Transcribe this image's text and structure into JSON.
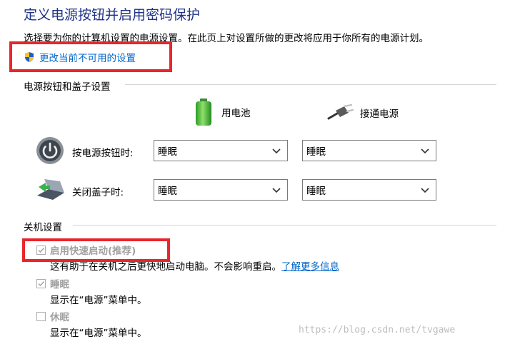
{
  "page": {
    "title": "定义电源按钮并启用密码保护",
    "description": "选择要为你的计算机设置的电源设置。在此页上对设置所做的更改将应用于你所有的电源计划。",
    "change_link": "更改当前不可用的设置"
  },
  "power_section": {
    "title": "电源按钮和盖子设置",
    "col_battery": "用电池",
    "col_plugged": "接通电源",
    "rows": [
      {
        "label": "按电源按钮时:",
        "battery": "睡眠",
        "plugged": "睡眠"
      },
      {
        "label": "关闭盖子时:",
        "battery": "睡眠",
        "plugged": "睡眠"
      }
    ]
  },
  "shutdown_section": {
    "title": "关机设置",
    "fast_startup": {
      "label": "启用快速启动(推荐)",
      "desc_hidden_part": "这有助于在关机之后更快地启动电脑。不会影响重启。",
      "learn_more": "了解更多信息",
      "checked": true
    },
    "sleep": {
      "label": "睡眠",
      "desc": "显示在“电源”菜单中。",
      "checked": true
    },
    "hibernate": {
      "label": "休眠",
      "desc": "显示在“电源”菜单中。",
      "checked": false
    }
  },
  "watermark": "https://blog.csdn.net/tvgawe",
  "colors": {
    "title": "#1e3287",
    "link": "#0066cc",
    "highlight": "#e8262c",
    "disabled": "#a0a0a0"
  }
}
